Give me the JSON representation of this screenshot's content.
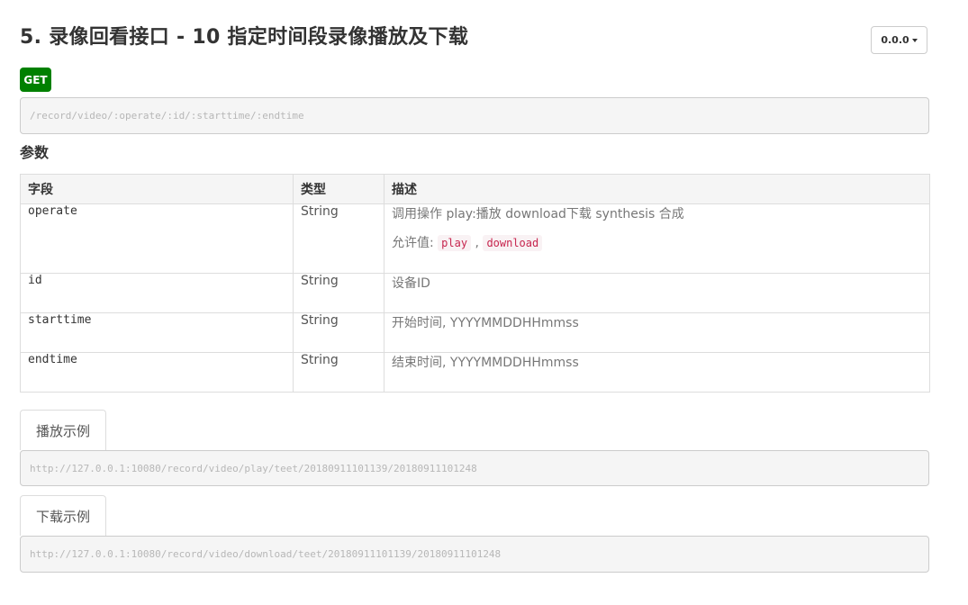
{
  "header": {
    "title": "5. 录像回看接口 - 10 指定时间段录像播放及下载",
    "version_label": "0.0.0"
  },
  "endpoint": {
    "method": "GET",
    "method_color": "#008000",
    "path": "/record/video/:operate/:id/:starttime/:endtime"
  },
  "params": {
    "section_title": "参数",
    "columns": [
      "字段",
      "类型",
      "描述"
    ],
    "rows": [
      {
        "field": "operate",
        "type": "String",
        "description": "调用操作 play:播放 download下载 synthesis 合成",
        "allowed_label": "允许值:",
        "allowed_values": [
          "play",
          "download"
        ],
        "allowed_separator": ","
      },
      {
        "field": "id",
        "type": "String",
        "description": "设备ID"
      },
      {
        "field": "starttime",
        "type": "String",
        "description": "开始时间, YYYYMMDDHHmmss"
      },
      {
        "field": "endtime",
        "type": "String",
        "description": "结束时间, YYYYMMDDHHmmss"
      }
    ]
  },
  "examples": [
    {
      "tab_label": "播放示例",
      "url": "http://127.0.0.1:10080/record/video/play/teet/20180911101139/20180911101248"
    },
    {
      "tab_label": "下载示例",
      "url": "http://127.0.0.1:10080/record/video/download/teet/20180911101139/20180911101248"
    }
  ],
  "colors": {
    "allowed_value_text": "#c7254e",
    "allowed_value_bg": "#f9f2f4"
  }
}
